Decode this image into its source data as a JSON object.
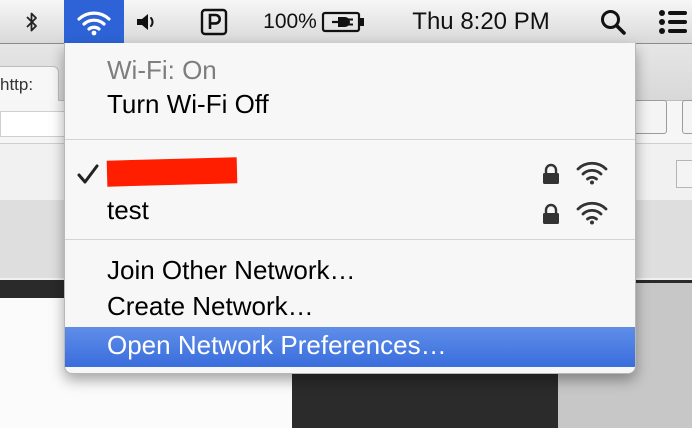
{
  "menubar": {
    "battery_percent": "100%",
    "clock": "Thu 8:20 PM",
    "icons": [
      "bluetooth-icon",
      "wifi-icon",
      "volume-icon",
      "parking-icon",
      "battery-charging-icon",
      "spotlight-search-icon",
      "notification-center-icon"
    ]
  },
  "background": {
    "tab_text": "http:"
  },
  "wifi_menu": {
    "status": "Wi-Fi: On",
    "toggle_label": "Turn Wi-Fi Off",
    "networks": [
      {
        "name": "",
        "connected": true,
        "redacted": true,
        "locked": true,
        "signal": "full"
      },
      {
        "name": "test",
        "connected": false,
        "redacted": false,
        "locked": true,
        "signal": "full"
      }
    ],
    "join_other": "Join Other Network…",
    "create_network": "Create Network…",
    "open_preferences": "Open Network Preferences…",
    "highlight_color": "#3a6ddd"
  }
}
